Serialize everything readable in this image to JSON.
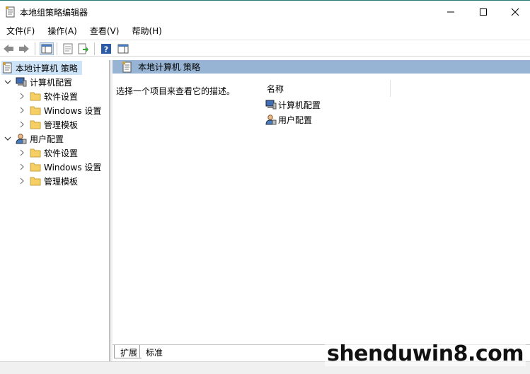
{
  "window": {
    "title": "本地组策略编辑器"
  },
  "menu": {
    "items": [
      "文件(F)",
      "操作(A)",
      "查看(V)",
      "帮助(H)"
    ]
  },
  "toolbar": {
    "icons": [
      "back-arrow-icon",
      "forward-arrow-icon",
      "show-hide-console-tree-icon",
      "properties-icon",
      "export-list-icon",
      "help-icon",
      "show-hide-action-pane-icon"
    ]
  },
  "tree": {
    "root": "本地计算机 策略",
    "computer": {
      "label": "计算机配置",
      "children": [
        "软件设置",
        "Windows 设置",
        "管理模板"
      ]
    },
    "user": {
      "label": "用户配置",
      "children": [
        "软件设置",
        "Windows 设置",
        "管理模板"
      ]
    }
  },
  "right": {
    "header_title": "本地计算机 策略",
    "description": "选择一个项目来查看它的描述。",
    "column_name": "名称",
    "rows": [
      "计算机配置",
      "用户配置"
    ]
  },
  "tabs": [
    "扩展",
    "标准"
  ],
  "watermark": "shenduwin8.com",
  "colors": {
    "selection": "#cde3f7",
    "header_bar": "#97b4d4",
    "folder": "#f5cf64"
  }
}
